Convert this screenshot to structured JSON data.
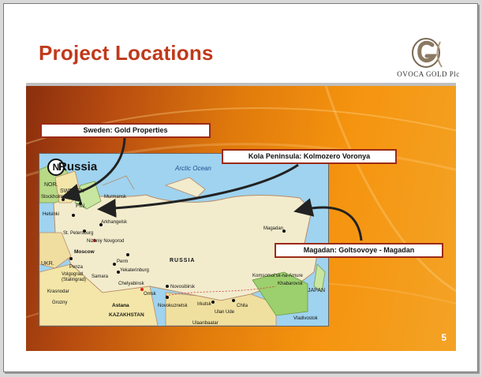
{
  "slide": {
    "title": "Project Locations",
    "page_number": "5"
  },
  "logo": {
    "text": "OVOCA GOLD Plc",
    "icon": "og-monogram-icon"
  },
  "callouts": {
    "sweden": "Sweden: Gold Properties",
    "kola": "Kola Peninsula: Kolmozero  Voronya",
    "magadan": "Magadan: Goltsovoye - Magadan"
  },
  "map": {
    "title": "Russia",
    "compass": "N",
    "ocean": "Arctic Ocean",
    "country_label": "RUSSIA",
    "countries": {
      "norway": "NOR.",
      "sweden": "SWEDEN",
      "finland": "FIN.",
      "ukraine": "UKR.",
      "kazakhstan": "KAZAKHSTAN",
      "japan": "JAPAN"
    },
    "cities": {
      "stockholm": "Stockholm",
      "helsinki": "Helsinki",
      "murmansk": "Murmansk",
      "arkhangelsk": "Arkhangelsk",
      "st_petersburg": "St. Petersburg",
      "nizhniy": "Nizhniy Novgorod",
      "moscow": "Moscow",
      "perm": "Perm",
      "penza": "Penza",
      "yekaterinburg": "Yekaterinburg",
      "volgograd": "Volgograd",
      "stalingrad": "(Stalingrad)",
      "samara": "Samara",
      "chelyabinsk": "Chelyabinsk",
      "krasnodar": "Krasnodar",
      "omsk": "Omsk",
      "novosibirsk": "Novosibirsk",
      "grozny": "Grozny",
      "astana": "Astana",
      "novokuznetsk": "Novokuznetsk",
      "irkutsk": "Irkutsk",
      "chita": "Chita",
      "ulan_ude": "Ulan Ude",
      "ulanbaatar": "Ulaanbaatar",
      "komsomolsk": "Komsomol'sk-na-Amure",
      "khabarovsk": "Khabarovsk",
      "vladivostok": "Vladivostok",
      "magadan": "Magadan"
    }
  }
}
